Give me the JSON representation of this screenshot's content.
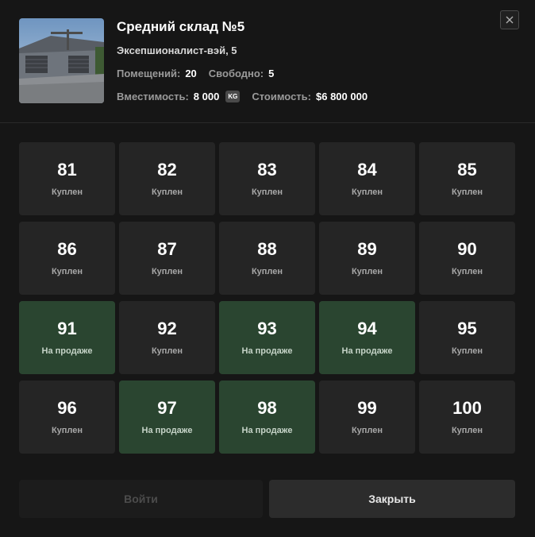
{
  "warehouse": {
    "title": "Средний склад №5",
    "address": "Эксепшионалист-вэй, 5",
    "rooms_label": "Помещений:",
    "rooms_value": "20",
    "free_label": "Свободно:",
    "free_value": "5",
    "capacity_label": "Вместимость:",
    "capacity_value": "8 000",
    "capacity_unit": "KG",
    "cost_label": "Стоимость:",
    "cost_value": "$6 800 000"
  },
  "icons": {
    "close": "close-icon"
  },
  "colors": {
    "sold": "#252525",
    "for_sale": "#2a4530",
    "background": "#161616"
  },
  "units": [
    {
      "number": "81",
      "status": "Куплен",
      "for_sale": false
    },
    {
      "number": "82",
      "status": "Куплен",
      "for_sale": false
    },
    {
      "number": "83",
      "status": "Куплен",
      "for_sale": false
    },
    {
      "number": "84",
      "status": "Куплен",
      "for_sale": false
    },
    {
      "number": "85",
      "status": "Куплен",
      "for_sale": false
    },
    {
      "number": "86",
      "status": "Куплен",
      "for_sale": false
    },
    {
      "number": "87",
      "status": "Куплен",
      "for_sale": false
    },
    {
      "number": "88",
      "status": "Куплен",
      "for_sale": false
    },
    {
      "number": "89",
      "status": "Куплен",
      "for_sale": false
    },
    {
      "number": "90",
      "status": "Куплен",
      "for_sale": false
    },
    {
      "number": "91",
      "status": "На продаже",
      "for_sale": true
    },
    {
      "number": "92",
      "status": "Куплен",
      "for_sale": false
    },
    {
      "number": "93",
      "status": "На продаже",
      "for_sale": true
    },
    {
      "number": "94",
      "status": "На продаже",
      "for_sale": true
    },
    {
      "number": "95",
      "status": "Куплен",
      "for_sale": false
    },
    {
      "number": "96",
      "status": "Куплен",
      "for_sale": false
    },
    {
      "number": "97",
      "status": "На продаже",
      "for_sale": true
    },
    {
      "number": "98",
      "status": "На продаже",
      "for_sale": true
    },
    {
      "number": "99",
      "status": "Куплен",
      "for_sale": false
    },
    {
      "number": "100",
      "status": "Куплен",
      "for_sale": false
    }
  ],
  "actions": {
    "enter_label": "Войти",
    "close_label": "Закрыть"
  }
}
